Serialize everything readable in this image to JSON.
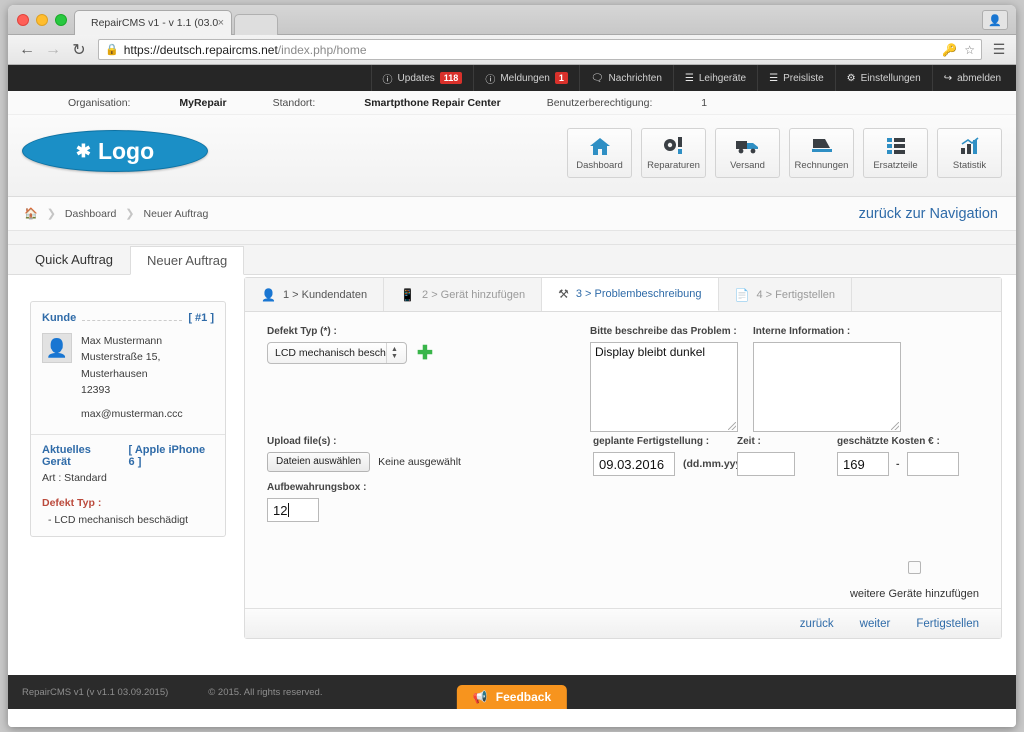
{
  "browser": {
    "tab_title": "RepairCMS v1 - v 1.1 (03.0",
    "tab_close": "×",
    "back_icon": "←",
    "forward_icon": "→",
    "reload_icon": "C",
    "lock_icon": "ὑ2",
    "url_secure": "https://deutsch.repaircms.net",
    "url_path": "/index.php/home",
    "key_icon": "key-icon",
    "star_icon": "☆",
    "menu_icon": "≡",
    "profile_icon": "●"
  },
  "topnav": [
    {
      "label": "Updates",
      "icon": "info-icon",
      "badge": "118"
    },
    {
      "label": "Meldungen",
      "icon": "info-icon",
      "badge": "1"
    },
    {
      "label": "Nachrichten",
      "icon": "comment-icon",
      "badge": ""
    },
    {
      "label": "Leihgeräte",
      "icon": "list-icon",
      "badge": ""
    },
    {
      "label": "Preisliste",
      "icon": "list-icon",
      "badge": ""
    },
    {
      "label": "Einstellungen",
      "icon": "gear-icon",
      "badge": ""
    },
    {
      "label": "abmelden",
      "icon": "logout-icon",
      "badge": ""
    }
  ],
  "orgbar": {
    "org_label": "Organisation:",
    "org_value": "MyRepair",
    "location_label": "Standort:",
    "location_value": "Smartpthone Repair Center",
    "permission_label": "Benutzerberechtigung:",
    "permission_value": "1"
  },
  "logo": {
    "text": "Logo",
    "icon": "wrench-screwdriver-icon"
  },
  "header_buttons": [
    {
      "label": "Dashboard",
      "icon": "home-icon"
    },
    {
      "label": "Reparaturen",
      "icon": "gear-wrench-icon"
    },
    {
      "label": "Versand",
      "icon": "truck-icon"
    },
    {
      "label": "Rechnungen",
      "icon": "invoice-icon"
    },
    {
      "label": "Ersatzteile",
      "icon": "parts-list-icon"
    },
    {
      "label": "Statistik",
      "icon": "chart-icon"
    }
  ],
  "breadcrumb": {
    "home_icon": "home-icon",
    "items": [
      "Dashboard",
      "Neuer Auftrag"
    ],
    "back_link": "zurück zur Navigation"
  },
  "main_tabs": [
    {
      "label": "Quick Auftrag",
      "active": false
    },
    {
      "label": "Neuer Auftrag",
      "active": true
    }
  ],
  "sidebar": {
    "customer_title": "Kunde",
    "customer_id": "[ #1 ]",
    "customer_name": "Max Mustermann",
    "customer_address": "Musterstraße 15, Musterhausen",
    "customer_zip": "12393",
    "customer_email": "max@musterman.ccc",
    "device_title": "Aktuelles Gerät",
    "device_value": "[ Apple iPhone 6 ]",
    "device_art": "Art : Standard",
    "defect_title": "Defekt Typ :",
    "defect_value": "- LCD mechanisch beschädigt"
  },
  "wizard": {
    "steps": [
      {
        "label": "1 > Kundendaten",
        "icon": "person-card-icon",
        "state": "done"
      },
      {
        "label": "2 > Gerät hinzufügen",
        "icon": "device-icon",
        "state": "todo"
      },
      {
        "label": "3 > Problembeschreibung",
        "icon": "tool-icon",
        "state": "active"
      },
      {
        "label": "4 > Fertigstellen",
        "icon": "document-icon",
        "state": "todo"
      }
    ],
    "defekt_typ_label": "Defekt Typ (*) :",
    "defekt_typ_value": "LCD mechanisch beschädigt",
    "defekt_typ_options": [
      "LCD mechanisch beschädigt"
    ],
    "add_icon": "plus-icon",
    "problem_label": "Bitte beschreibe das Problem :",
    "problem_value": "Display bleibt dunkel",
    "intern_label": "Interne Information :",
    "intern_value": "",
    "upload_label": "Upload file(s) :",
    "upload_button": "Dateien auswählen",
    "upload_status": "Keine ausgewählt",
    "box_label": "Aufbewahrungsbox :",
    "box_value": "12",
    "date_label": "geplante Fertigstellung :",
    "date_value": "09.03.2016",
    "date_hint": "(dd.mm.yyyy)",
    "time_label": "Zeit :",
    "time_value": "",
    "cost_label": "geschätzte Kosten € :",
    "cost_min": "169",
    "cost_sep": "-",
    "cost_max": "",
    "more_devices_label": "weitere Geräte hinzufügen",
    "more_devices_checked": false,
    "footer_links": [
      "zurück",
      "weiter",
      "Fertigstellen"
    ]
  },
  "footer": {
    "version": "RepairCMS v1 (v v1.1 03.09.2015)",
    "copyright": "© 2015. All rights reserved.",
    "feedback_label": "Feedback",
    "feedback_icon": "megaphone-icon"
  },
  "colors": {
    "accent_blue": "#2f6ba8",
    "logo_blue": "#1b8fc6",
    "badge_red": "#d9312b",
    "defect_red": "#bb4a3c",
    "plus_green": "#39b54a",
    "feedback_orange": "#f7941e",
    "dark_nav": "#262626"
  }
}
